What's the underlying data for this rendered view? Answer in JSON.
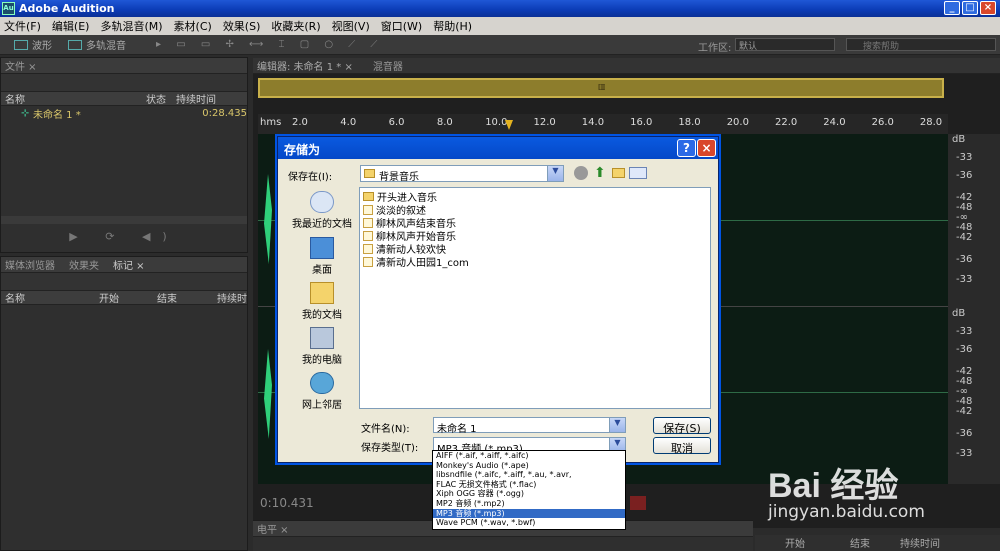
{
  "app": {
    "title": "Adobe Audition",
    "icon_text": "Au"
  },
  "window_buttons": {
    "minimize": "_",
    "maximize": "□",
    "close": "×"
  },
  "menu": [
    "文件(F)",
    "编辑(E)",
    "多轨混音(M)",
    "素材(C)",
    "效果(S)",
    "收藏夹(R)",
    "视图(V)",
    "窗口(W)",
    "帮助(H)"
  ],
  "toolbar": {
    "waveform": "波形",
    "multitrack": "多轨混音",
    "workspace_label": "工作区:",
    "workspace_value": "默认",
    "search_placeholder": "搜索帮助"
  },
  "files_panel": {
    "tab": "文件 ×",
    "columns": [
      "名称",
      "状态",
      "持续时间"
    ],
    "items": [
      {
        "name": "未命名 1 *",
        "duration": "0:28.435"
      }
    ]
  },
  "markers_panel": {
    "tabs": [
      "媒体浏览器",
      "效果夹",
      "标记 ×"
    ],
    "columns": [
      "名称",
      "开始",
      "结束",
      "持续时"
    ]
  },
  "editor": {
    "tabs": [
      "编辑器: 未命名 1 * ×",
      "混音器"
    ],
    "ruler_unit": "hms",
    "ruler_ticks": [
      "2.0",
      "4.0",
      "6.0",
      "8.0",
      "10.0",
      "12.0",
      "14.0",
      "16.0",
      "18.0",
      "20.0",
      "22.0",
      "24.0",
      "26.0",
      "28.0"
    ],
    "db_labels_top": [
      "dB",
      "-33",
      "-36",
      "-42",
      "-48",
      "-∞",
      "-48",
      "-42",
      "-36",
      "-33"
    ],
    "db_labels_bottom": [
      "dB",
      "-33",
      "-36",
      "-42",
      "-48",
      "-∞",
      "-48",
      "-42",
      "-36",
      "-33"
    ],
    "time": "0:10.431"
  },
  "dialog": {
    "title": "存储为",
    "save_in_label": "保存在(I):",
    "save_in_value": "背景音乐",
    "places": [
      "我最近的文档",
      "桌面",
      "我的文档",
      "我的电脑",
      "网上邻居"
    ],
    "files": [
      {
        "name": "开头进入音乐",
        "type": "folder"
      },
      {
        "name": "淡淡的叙述",
        "type": "file"
      },
      {
        "name": "柳林风声结束音乐",
        "type": "file"
      },
      {
        "name": "柳林风声开始音乐",
        "type": "file"
      },
      {
        "name": "清新动人较欢快",
        "type": "file"
      },
      {
        "name": "清新动人田园1_com",
        "type": "file"
      }
    ],
    "filename_label": "文件名(N):",
    "filename_value": "未命名 1",
    "filetype_label": "保存类型(T):",
    "filetype_value": "MP3 音频 (*.mp3)",
    "save_button": "保存(S)",
    "cancel_button": "取消",
    "help_button": "?",
    "close_button": "×"
  },
  "filetype_options": [
    "AIFF (*.aif, *.aiff, *.aifc)",
    "Monkey's Audio (*.ape)",
    "libsndfile (*.aifc, *.aiff, *.au, *.avr,",
    "FLAC 无损文件格式 (*.flac)",
    "Xiph OGG 容器 (*.ogg)",
    "MP2 音频 (*.mp2)",
    "MP3 音频 (*.mp3)",
    "Wave PCM (*.wav, *.bwf)"
  ],
  "selected_filetype_index": 6,
  "bottom_panel": {
    "tabs": [
      "电平 ×"
    ],
    "columns": [
      "开始",
      "结束",
      "持续时间"
    ]
  },
  "watermark": {
    "text": "Bai 经验",
    "url": "jingyan.baidu.com"
  },
  "colors": {
    "titlebar": "#0a46c9",
    "waveform": "#2fd07a",
    "dialog_bg": "#ece9d8",
    "selection": "#316ac5"
  }
}
